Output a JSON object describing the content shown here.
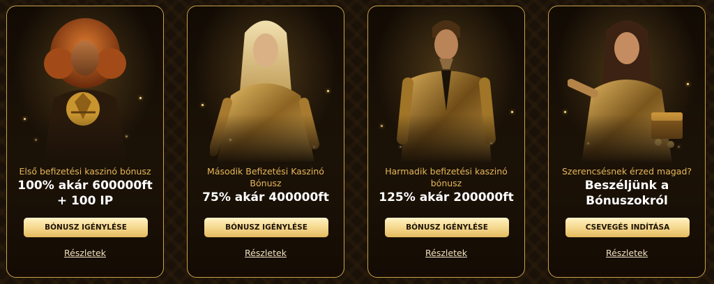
{
  "colors": {
    "accent_gold": "#c9a24a",
    "subtitle_gold": "#e6b85a",
    "button_gold": "#f4d68a",
    "background": "#1a1108"
  },
  "cards": [
    {
      "subtitle": "Első befizetési kaszinó bónusz",
      "headline_1": "100% akár 600000ft",
      "headline_2": "+ 100 IP",
      "cta": "BÓNUSZ IGÉNYLÉSE",
      "details": "Részletek",
      "art": "woman-with-red-curly-hair-holding-gold-ornament"
    },
    {
      "subtitle": "Második Befizetési Kaszinó Bónusz",
      "headline_1": "75% akár 400000ft",
      "headline_2": "",
      "cta": "BÓNUSZ IGÉNYLÉSE",
      "details": "Részletek",
      "art": "blonde-woman-in-gold-satin"
    },
    {
      "subtitle": "Harmadik befizetési kaszinó bónusz",
      "headline_1": "125% akár 200000ft",
      "headline_2": "",
      "cta": "BÓNUSZ IGÉNYLÉSE",
      "details": "Részletek",
      "art": "man-in-gold-suit"
    },
    {
      "subtitle": "Szerencsésnek érzed magad?",
      "headline_1": "Beszéljünk a",
      "headline_2": "Bónuszokról",
      "cta": "CSEVEGÉS INDÍTÁSA",
      "details": "Részletek",
      "art": "brunette-woman-with-treasure-chest"
    }
  ]
}
